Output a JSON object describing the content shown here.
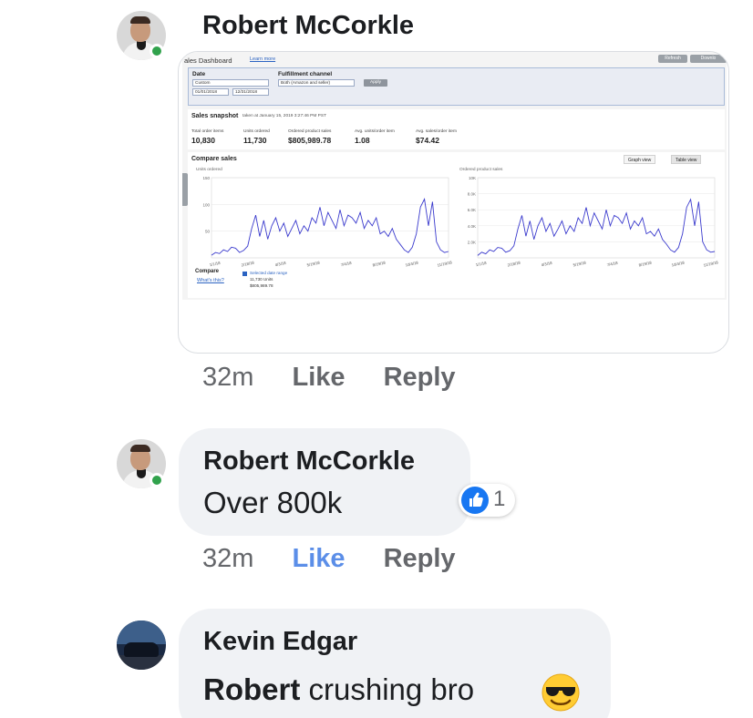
{
  "comments": [
    {
      "author": "Robert McCorkle",
      "time": "32m",
      "like_label": "Like",
      "reply_label": "Reply",
      "attachment": {
        "title": "ales Dashboard",
        "learn_more": "Learn more",
        "refresh": "Refresh",
        "download": "Downlo",
        "filters": {
          "date_label": "Date",
          "date_value": "Custom",
          "date_from": "01/01/2018",
          "date_to": "12/31/2018",
          "fulfillment_label": "Fulfillment channel",
          "fulfillment_value": "Both (Amazon and seller)",
          "apply": "Apply"
        },
        "snapshot": {
          "title": "Sales snapshot",
          "subtitle": "taken at January 15, 2019 3:27:46 PM PST",
          "metrics": [
            {
              "label": "Total order items",
              "value": "10,830"
            },
            {
              "label": "Units ordered",
              "value": "11,730"
            },
            {
              "label": "Ordered product sales",
              "value": "$805,989.78"
            },
            {
              "label": "Avg. units/order item",
              "value": "1.08"
            },
            {
              "label": "Avg. sales/order item",
              "value": "$74.42"
            }
          ]
        },
        "compare": {
          "title": "Compare sales",
          "graph_view": "Graph view",
          "table_view": "Table view",
          "compare_label": "Compare",
          "whats_this": "What's this?",
          "selected_range": "Selected date range",
          "units_line": "11,730 Units",
          "sales_line": "$805,989.78"
        },
        "chart_data": [
          {
            "type": "line",
            "ylabel": "Units ordered",
            "ylim": [
              0,
              150
            ],
            "yticks": [
              "150",
              "100",
              "50"
            ],
            "xticks": [
              "1/1/18",
              "2/18/18",
              "4/3/18",
              "5/19/18",
              "7/4/18",
              "8/19/18",
              "10/4/18",
              "11/19/18"
            ],
            "series": [
              {
                "values": [
                  5,
                  10,
                  8,
                  15,
                  12,
                  20,
                  18,
                  10,
                  14,
                  22,
                  55,
                  80,
                  40,
                  70,
                  35,
                  60,
                  75,
                  50,
                  65,
                  40,
                  55,
                  70,
                  45,
                  60,
                  50,
                  75,
                  65,
                  95,
                  60,
                  85,
                  70,
                  55,
                  90,
                  60,
                  80,
                  75,
                  65,
                  85,
                  55,
                  70,
                  60,
                  75,
                  45,
                  50,
                  40,
                  55,
                  35,
                  25,
                  15,
                  10,
                  20,
                  45,
                  95,
                  110,
                  60,
                  105,
                  30,
                  15,
                  10,
                  12
                ]
              }
            ]
          },
          {
            "type": "line",
            "ylabel": "Ordered product sales",
            "ylim": [
              0,
              10000
            ],
            "yticks": [
              "10K",
              "8.0K",
              "6.0K",
              "4.0K",
              "2.0K"
            ],
            "xticks": [
              "1/1/18",
              "2/18/18",
              "4/3/18",
              "5/19/18",
              "7/4/18",
              "8/19/18",
              "10/4/18",
              "11/19/18"
            ],
            "series": [
              {
                "values": [
                  300,
                  700,
                  500,
                  1000,
                  800,
                  1300,
                  1200,
                  700,
                  900,
                  1500,
                  3600,
                  5300,
                  2700,
                  4600,
                  2300,
                  4000,
                  5000,
                  3300,
                  4300,
                  2700,
                  3600,
                  4600,
                  3000,
                  4000,
                  3300,
                  5000,
                  4300,
                  6300,
                  4000,
                  5600,
                  4600,
                  3600,
                  6000,
                  4000,
                  5300,
                  5000,
                  4300,
                  5600,
                  3600,
                  4600,
                  4000,
                  5000,
                  3000,
                  3300,
                  2700,
                  3600,
                  2300,
                  1700,
                  1000,
                  700,
                  1300,
                  3000,
                  6300,
                  7300,
                  4000,
                  7000,
                  2000,
                  1000,
                  700,
                  800
                ]
              }
            ]
          }
        ]
      }
    },
    {
      "author": "Robert McCorkle",
      "text": "Over 800k",
      "reaction_count": "1",
      "time": "32m",
      "like_label": "Like",
      "reply_label": "Reply"
    },
    {
      "author": "Kevin Edgar",
      "mention": "Robert",
      "text": " crushing bro",
      "emoji": "smiling-face-with-sunglasses"
    }
  ],
  "colors": {
    "like_active": "#5b8ee8",
    "bubble_bg": "#f0f2f5",
    "online": "#31a24c",
    "reaction_blue": "#1877f2",
    "chart_line": "#3a3acd"
  }
}
